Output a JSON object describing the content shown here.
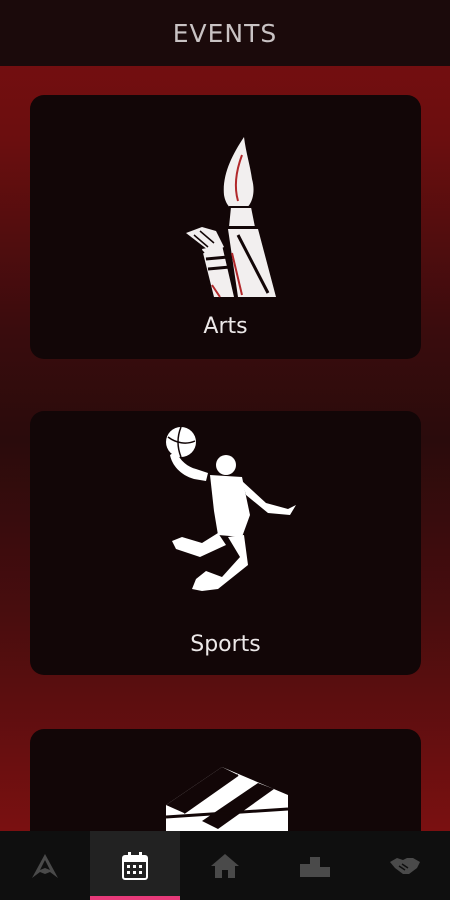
{
  "header": {
    "title": "EVENTS"
  },
  "cards": [
    {
      "label": "Arts",
      "icon": "paintbrush-icon"
    },
    {
      "label": "Sports",
      "icon": "basketball-player-icon"
    },
    {
      "label": "",
      "icon": "box-icon"
    }
  ],
  "navbar": {
    "items": [
      {
        "icon": "logo-icon",
        "active": false
      },
      {
        "icon": "calendar-icon",
        "active": true
      },
      {
        "icon": "home-icon",
        "active": false
      },
      {
        "icon": "podium-icon",
        "active": false
      },
      {
        "icon": "handshake-icon",
        "active": false
      }
    ]
  },
  "colors": {
    "accent": "#e83a7a",
    "background_red": "#7a0f10",
    "card": "#120607",
    "header": "#1b0a0b"
  }
}
